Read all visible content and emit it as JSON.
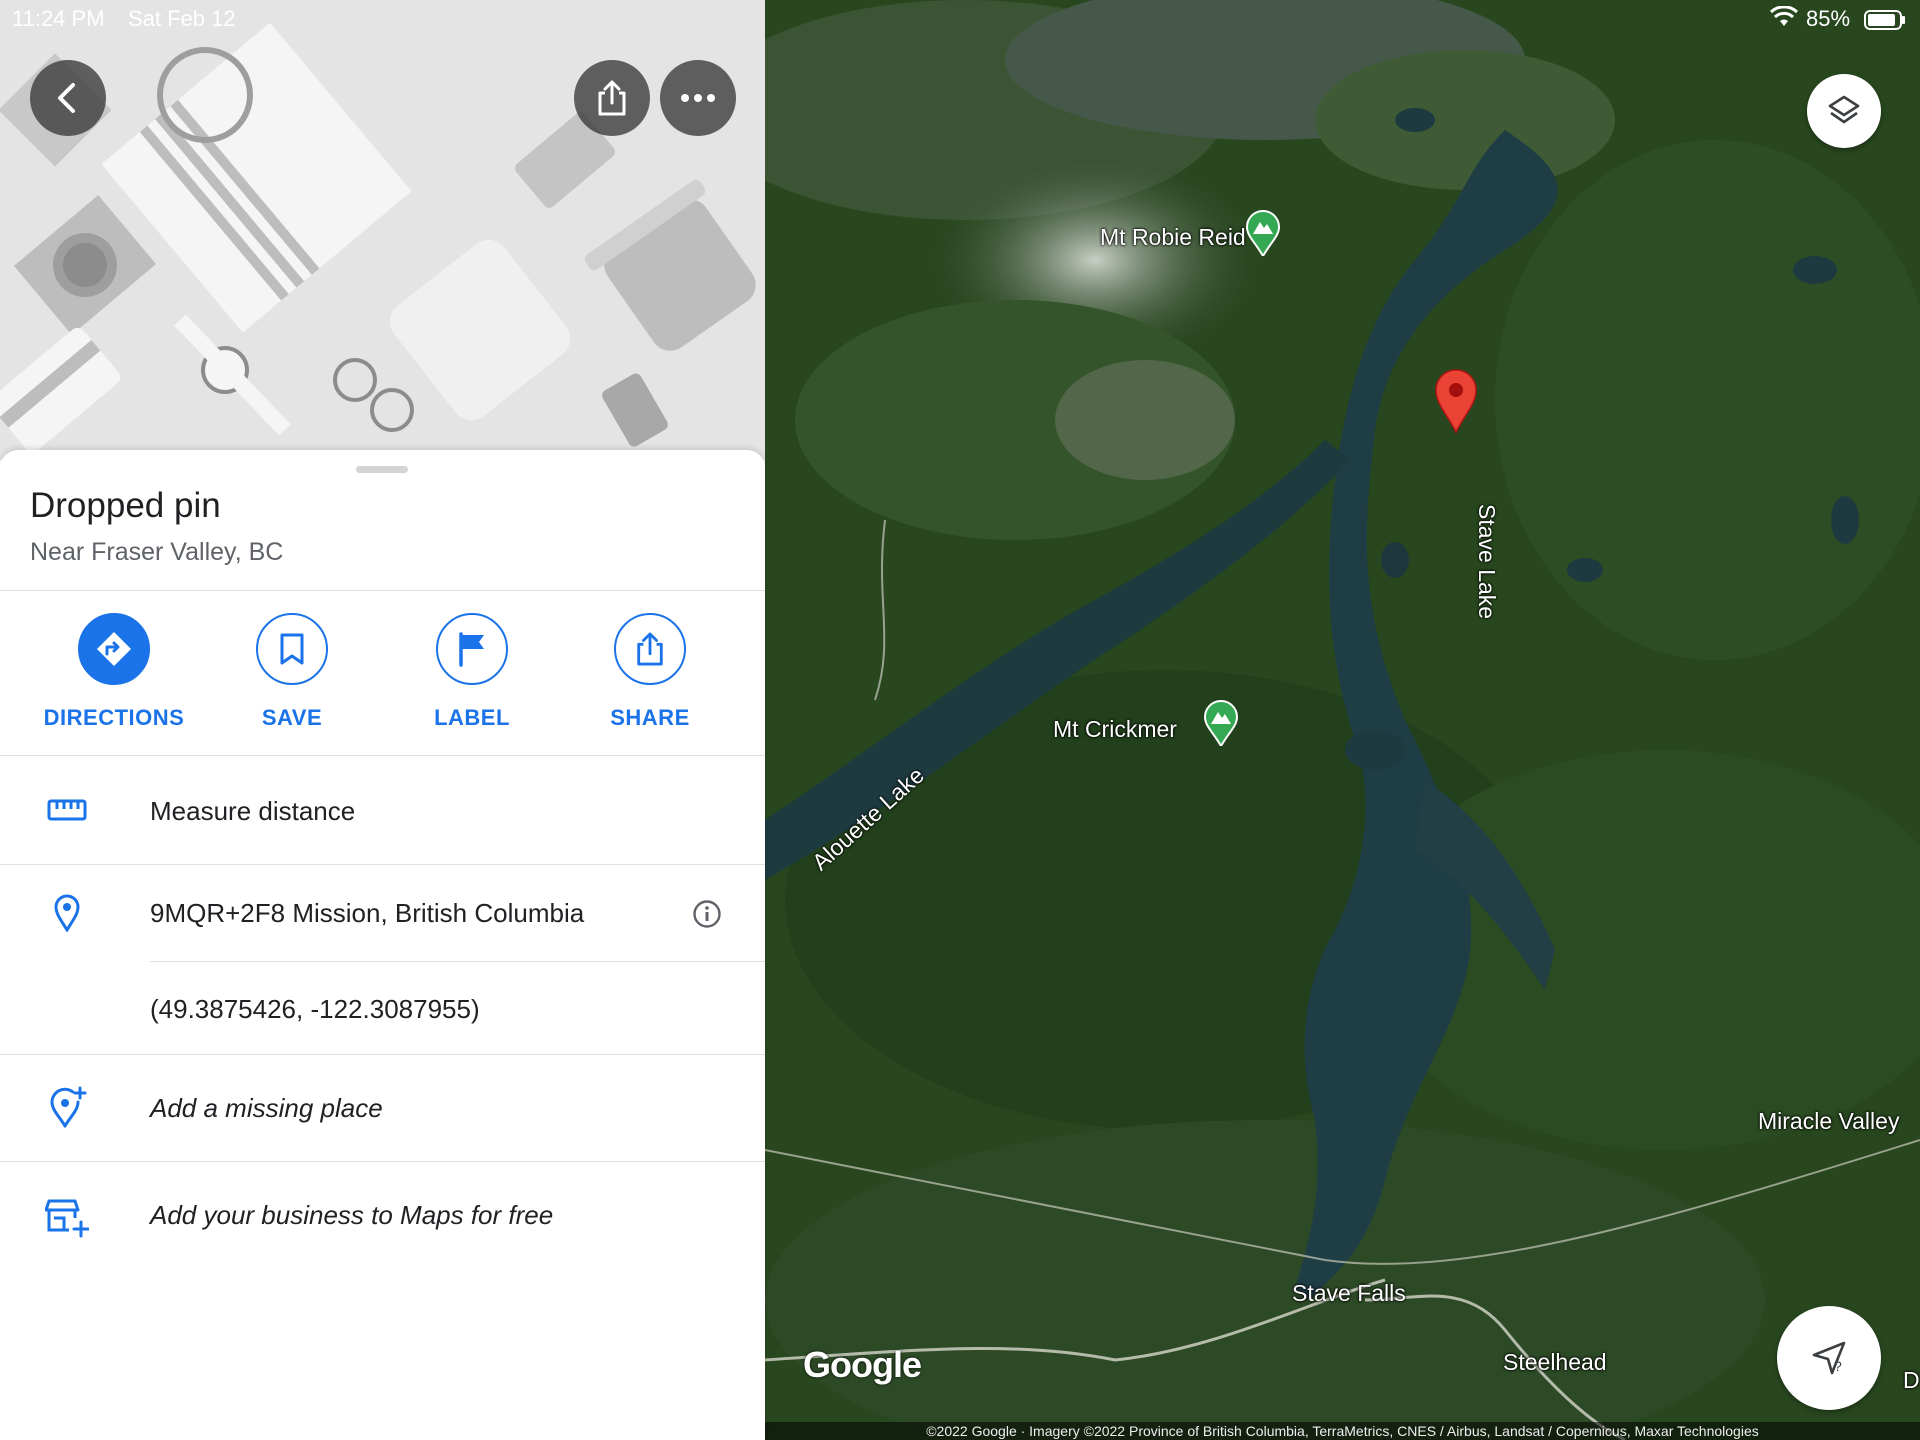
{
  "status_bar": {
    "time": "11:24 PM",
    "date": "Sat Feb 12",
    "battery": "85%"
  },
  "place": {
    "title": "Dropped pin",
    "subtitle": "Near Fraser Valley, BC"
  },
  "actions": [
    {
      "label": "DIRECTIONS",
      "icon": "directions-icon"
    },
    {
      "label": "SAVE",
      "icon": "bookmark-icon"
    },
    {
      "label": "LABEL",
      "icon": "flag-icon"
    },
    {
      "label": "SHARE",
      "icon": "share-icon"
    }
  ],
  "rows": {
    "measure": "Measure distance",
    "plus_code": "9MQR+2F8 Mission, British Columbia",
    "coordinates": "(49.3875426, -122.3087955)",
    "missing_place": "Add a missing place",
    "business": "Add your business to Maps for free"
  },
  "map": {
    "labels": {
      "mt_robie_reid": "Mt Robie Reid",
      "mt_crickmer": "Mt Crickmer",
      "stave_lake": "Stave Lake",
      "alouette_lake": "Alouette Lake",
      "miracle_valley": "Miracle Valley",
      "stave_falls": "Stave Falls",
      "steelhead": "Steelhead",
      "edge_letter": "D"
    },
    "logo": "Google",
    "attribution": "©2022 Google · Imagery ©2022 Province of British Columbia, TerraMetrics, CNES / Airbus, Landsat / Copernicus, Maxar Technologies"
  },
  "colors": {
    "accent": "#1a73e8",
    "pin": "#ea4335",
    "peak": "#34a853"
  }
}
